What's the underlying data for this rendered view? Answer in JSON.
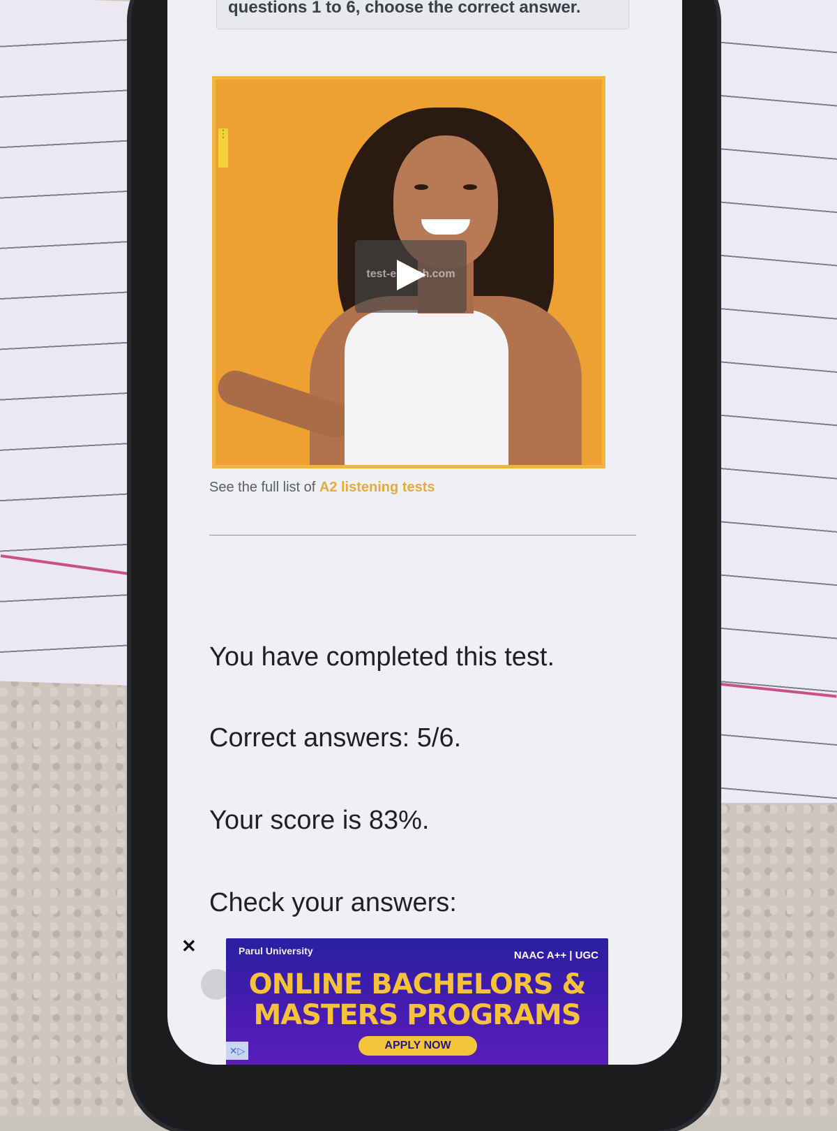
{
  "instruction": {
    "text": "questions 1 to 6, choose the correct answer."
  },
  "video": {
    "watermark": "test-english.com",
    "menu_dots": "⋮"
  },
  "list_link": {
    "prefix": "See the full list of ",
    "link": "A2 listening tests"
  },
  "results": {
    "completed": "You have completed this test.",
    "correct": "Correct answers: 5/6.",
    "score": "Your score is 83%.",
    "check": "Check your answers:"
  },
  "ad": {
    "close": "✕",
    "university": "Parul University",
    "badges": "NAAC A++ | UGC",
    "headline_line1": "ONLINE BACHELORS &",
    "headline_line2": "MASTERS PROGRAMS",
    "cta": "APPLY NOW",
    "choices": "✕▷"
  },
  "colors": {
    "accent": "#e7a93a",
    "ad_bg": "#4a1cb2",
    "ad_text": "#f6c23a"
  }
}
